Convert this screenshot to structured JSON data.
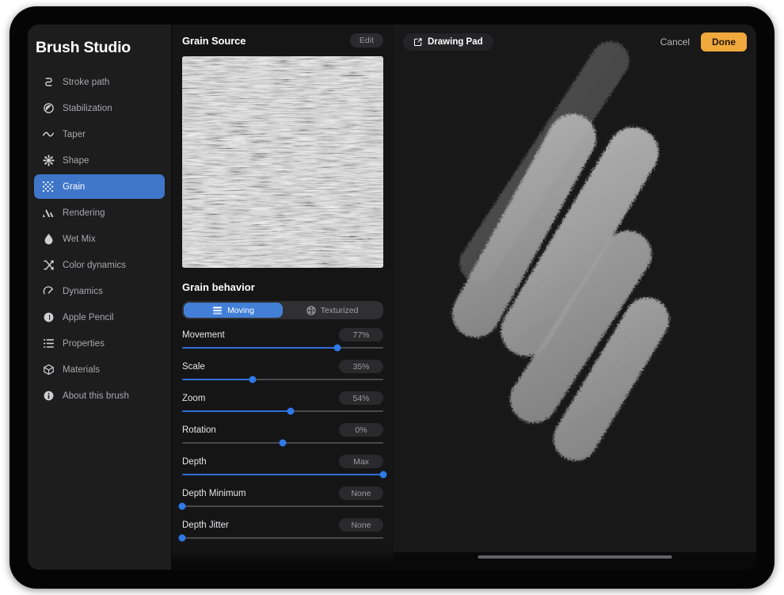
{
  "app": {
    "title": "Brush Studio"
  },
  "sidebar": {
    "items": [
      {
        "label": "Stroke path",
        "icon": "stroke-path-icon",
        "active": false
      },
      {
        "label": "Stabilization",
        "icon": "stabilization-icon",
        "active": false
      },
      {
        "label": "Taper",
        "icon": "taper-icon",
        "active": false
      },
      {
        "label": "Shape",
        "icon": "shape-icon",
        "active": false
      },
      {
        "label": "Grain",
        "icon": "grain-icon",
        "active": true
      },
      {
        "label": "Rendering",
        "icon": "rendering-icon",
        "active": false
      },
      {
        "label": "Wet Mix",
        "icon": "wet-mix-icon",
        "active": false
      },
      {
        "label": "Color dynamics",
        "icon": "color-dynamics-icon",
        "active": false
      },
      {
        "label": "Dynamics",
        "icon": "dynamics-icon",
        "active": false
      },
      {
        "label": "Apple Pencil",
        "icon": "apple-pencil-icon",
        "active": false
      },
      {
        "label": "Properties",
        "icon": "properties-icon",
        "active": false
      },
      {
        "label": "Materials",
        "icon": "materials-icon",
        "active": false
      },
      {
        "label": "About this brush",
        "icon": "info-icon",
        "active": false
      }
    ]
  },
  "grain_source": {
    "title": "Grain Source",
    "edit_label": "Edit",
    "preview_alt": "grain-texture-preview"
  },
  "grain_behavior": {
    "title": "Grain behavior",
    "modes": [
      {
        "label": "Moving",
        "icon": "moving-icon",
        "selected": true
      },
      {
        "label": "Texturized",
        "icon": "texturized-icon",
        "selected": false
      }
    ],
    "sliders": [
      {
        "label": "Movement",
        "value": "77%",
        "percent": 77,
        "mode": "fill"
      },
      {
        "label": "Scale",
        "value": "35%",
        "percent": 35,
        "mode": "fill"
      },
      {
        "label": "Zoom",
        "value": "54%",
        "percent": 54,
        "mode": "fill"
      },
      {
        "label": "Rotation",
        "value": "0%",
        "percent": 50,
        "mode": "center"
      },
      {
        "label": "Depth",
        "value": "Max",
        "percent": 100,
        "mode": "fill"
      },
      {
        "label": "Depth Minimum",
        "value": "None",
        "percent": 0,
        "mode": "fill"
      },
      {
        "label": "Depth Jitter",
        "value": "None",
        "percent": 0,
        "mode": "fill"
      }
    ]
  },
  "canvas": {
    "drawing_pad_label": "Drawing Pad",
    "drawing_pad_icon": "compose-icon",
    "cancel_label": "Cancel",
    "done_label": "Done"
  },
  "colors": {
    "accent_blue": "#3f76c9",
    "slider_blue": "#2f6ed4",
    "done_orange": "#f0a93c",
    "sidebar_bg": "#1d1d1e",
    "panel_bg": "#151516",
    "canvas_bg": "#181819"
  }
}
